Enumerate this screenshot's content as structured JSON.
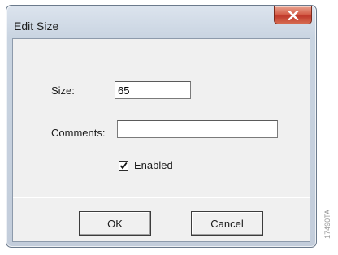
{
  "window": {
    "title": "Edit Size",
    "close_icon": "close-x-icon"
  },
  "form": {
    "size_label": "Size:",
    "size_value": "65",
    "comments_label": "Comments:",
    "comments_value": "",
    "enabled_label": "Enabled",
    "enabled_checked": true
  },
  "buttons": {
    "ok_label": "OK",
    "cancel_label": "Cancel"
  },
  "figure": {
    "side_code": "17490TA"
  },
  "colors": {
    "close_button": "#c0392b",
    "frame": "#c3cddb",
    "client_bg": "#f0f0f0"
  }
}
